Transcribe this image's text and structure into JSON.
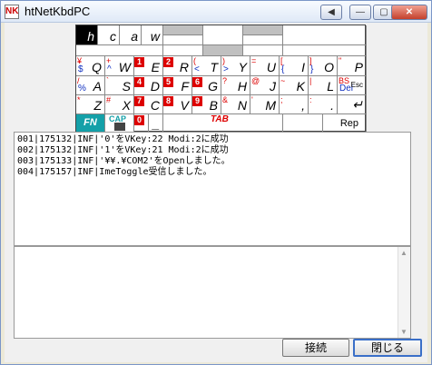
{
  "window": {
    "title": "htNetKbdPC",
    "icon_text": "NK",
    "title_buttons": [
      "◀",
      "—",
      "▢",
      "✕"
    ]
  },
  "keyboard": {
    "row1": [
      "h",
      "c",
      "a",
      "w"
    ],
    "row2": [
      {
        "main": "Q",
        "red": "¥",
        "blue": "$"
      },
      {
        "main": "W",
        "red": "+",
        "blue": "^"
      },
      {
        "main": "E",
        "num": "1"
      },
      {
        "main": "R",
        "num": "2"
      },
      {
        "main": "T",
        "red": "(",
        "blue": "<"
      },
      {
        "main": "Y",
        "red": ")",
        "blue": ">"
      },
      {
        "main": "U",
        "red": "="
      },
      {
        "main": "I",
        "red": "[",
        "blue": "{"
      },
      {
        "main": "O",
        "red": "]",
        "blue": "}"
      },
      {
        "main": "P",
        "red": "\""
      }
    ],
    "row3": [
      {
        "main": "A",
        "red": "/",
        "blue": "%"
      },
      {
        "main": "S",
        "red": "`"
      },
      {
        "main": "D",
        "num": "4"
      },
      {
        "main": "F",
        "num": "5"
      },
      {
        "main": "G",
        "num": "6"
      },
      {
        "main": "H",
        "red": "?"
      },
      {
        "main": "J",
        "red": "@"
      },
      {
        "main": "K",
        "red": "~"
      },
      {
        "main": "L",
        "red": "|"
      },
      {
        "main": "Esc",
        "red": "BS",
        "blue": "Del"
      }
    ],
    "row4": [
      {
        "main": "Z",
        "red": "*"
      },
      {
        "main": "X",
        "red": "#"
      },
      {
        "main": "C",
        "num": "7"
      },
      {
        "main": "V",
        "num": "8"
      },
      {
        "main": "B",
        "num": "9"
      },
      {
        "main": "N",
        "red": "&"
      },
      {
        "main": "M",
        "red": "'"
      },
      {
        "main": ",",
        "red": ";"
      },
      {
        "main": ".",
        "red": ":"
      },
      {
        "main": "↵"
      }
    ],
    "row5": {
      "fn": "FN",
      "cap": "CAP",
      "zero": "0",
      "dash": "_",
      "tab": "TAB",
      "rep": "Rep"
    }
  },
  "log": {
    "lines": [
      "001|175132|INF|'0'をVKey:22 Modi:2に成功",
      "002|175132|INF|'1'をVKey:21 Modi:2に成功",
      "003|175133|INF|'¥¥.¥COM2'をOpenしました。",
      "004|175157|INF|ImeToggle受信しました。"
    ]
  },
  "buttons": {
    "connect": "接続",
    "close": "閉じる"
  }
}
